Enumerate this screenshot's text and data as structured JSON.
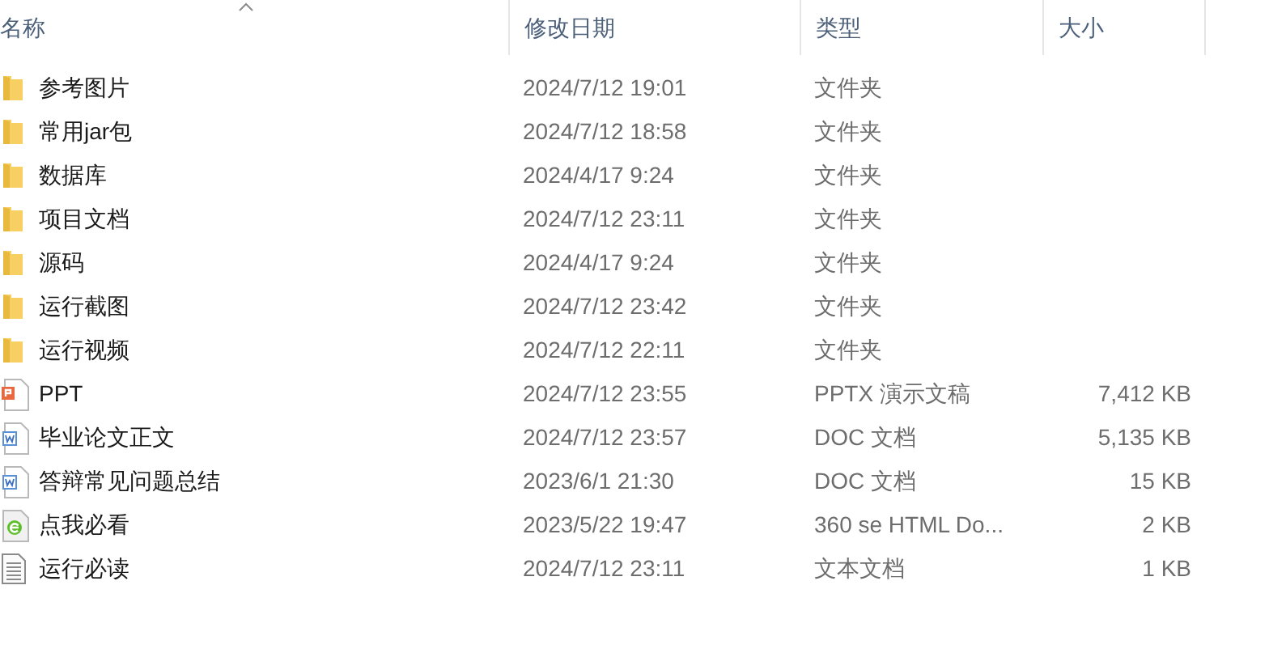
{
  "columns": [
    {
      "label": "名称",
      "sorted": true
    },
    {
      "label": "修改日期",
      "sorted": false
    },
    {
      "label": "类型",
      "sorted": false
    },
    {
      "label": "大小",
      "sorted": false
    }
  ],
  "files": [
    {
      "kind": "folder",
      "name": "参考图片",
      "date": "2024/7/12 19:01",
      "type": "文件夹"
    },
    {
      "kind": "folder",
      "name": "常用jar包",
      "date": "2024/7/12 18:58",
      "type": "文件夹"
    },
    {
      "kind": "folder",
      "name": "数据库",
      "date": "2024/4/17 9:24",
      "type": "文件夹"
    },
    {
      "kind": "folder",
      "name": "项目文档",
      "date": "2024/7/12 23:11",
      "type": "文件夹"
    },
    {
      "kind": "folder",
      "name": "源码",
      "date": "2024/4/17 9:24",
      "type": "文件夹"
    },
    {
      "kind": "folder",
      "name": "运行截图",
      "date": "2024/7/12 23:42",
      "type": "文件夹"
    },
    {
      "kind": "folder",
      "name": "运行视频",
      "date": "2024/7/12 22:11",
      "type": "文件夹"
    },
    {
      "kind": "ppt",
      "name": "PPT",
      "date": "2024/7/12 23:55",
      "type": "PPTX 演示文稿",
      "size": "7,412 KB"
    },
    {
      "kind": "word",
      "name": "毕业论文正文",
      "date": "2024/7/12 23:57",
      "type": "DOC 文档",
      "size": "5,135 KB"
    },
    {
      "kind": "word",
      "name": "答辩常见问题总结",
      "date": "2023/6/1 21:30",
      "type": "DOC 文档",
      "size": "15 KB"
    },
    {
      "kind": "html",
      "name": "点我必看",
      "date": "2023/5/22 19:47",
      "type": "360 se HTML Do...",
      "size": "2 KB"
    },
    {
      "kind": "text",
      "name": "运行必读",
      "date": "2024/7/12 23:11",
      "type": "文本文档",
      "size": "1 KB"
    }
  ]
}
